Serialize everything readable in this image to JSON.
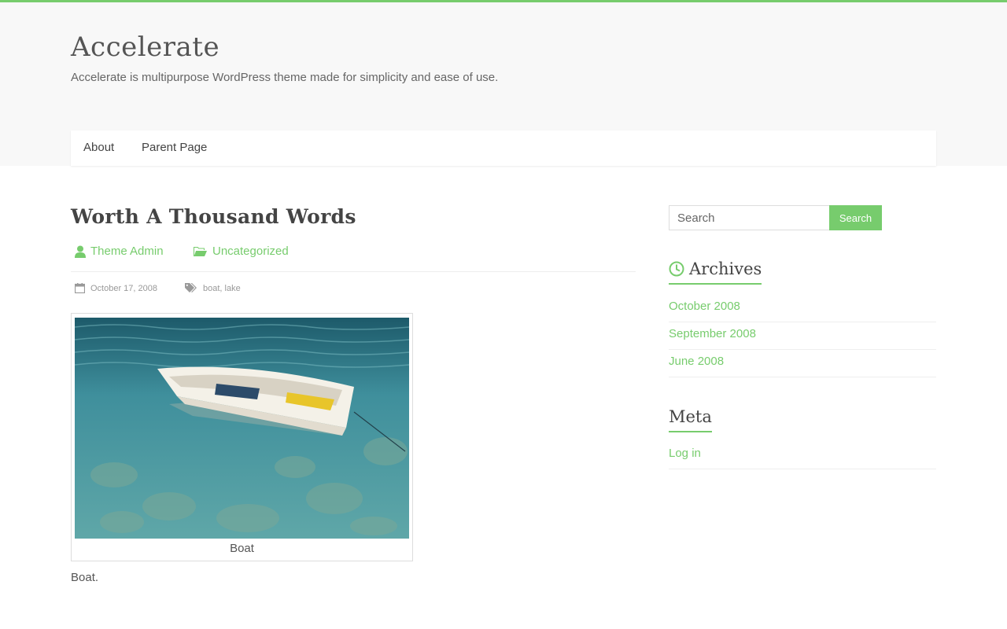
{
  "site": {
    "title": "Accelerate",
    "description": "Accelerate is multipurpose WordPress theme made for simplicity and ease of use."
  },
  "nav": {
    "items": [
      "About",
      "Parent Page"
    ]
  },
  "post": {
    "title": "Worth A Thousand Words",
    "author": "Theme Admin",
    "category": "Uncategorized",
    "date": "October 17, 2008",
    "tags": [
      "boat",
      "lake"
    ],
    "tag_separator": ",",
    "caption": "Boat",
    "body": "Boat."
  },
  "sidebar": {
    "search": {
      "placeholder": "Search",
      "button_label": "Search"
    },
    "archives": {
      "title": "Archives",
      "items": [
        "October 2008",
        "September 2008",
        "June 2008"
      ]
    },
    "meta": {
      "title": "Meta",
      "items": [
        "Log in"
      ]
    }
  },
  "colors": {
    "accent": "#77cc6d",
    "header_bg": "#f8f8f8",
    "text": "#444444"
  },
  "icons": {
    "author": "user-icon",
    "category": "folder-open-icon",
    "date": "calendar-icon",
    "tags": "tags-icon",
    "archives": "clock-icon"
  }
}
